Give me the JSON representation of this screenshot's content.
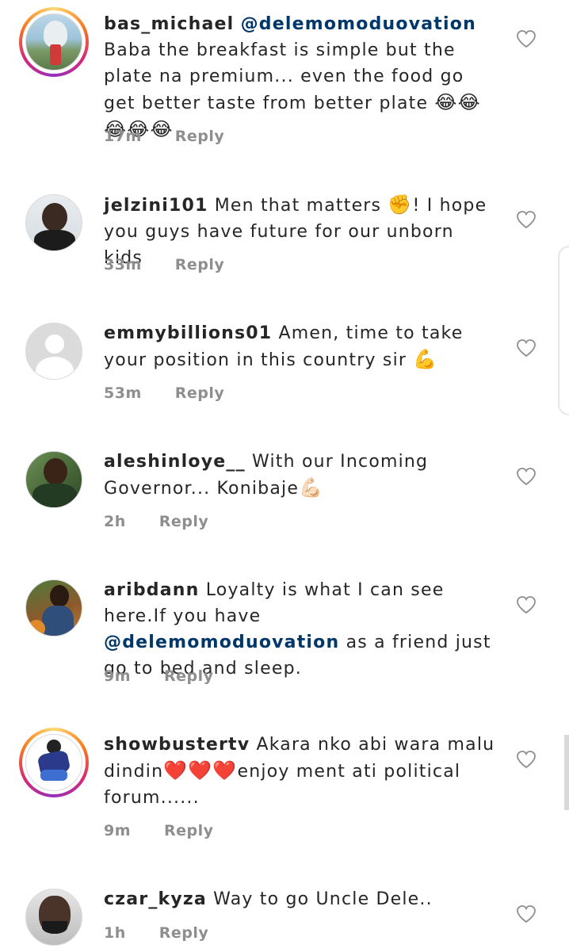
{
  "comments": [
    {
      "username": "bas_michael",
      "mention": "@delemomoduovation",
      "text": "Baba the breakfast is simple but the plate na premium... even the food go get better taste from better plate",
      "emoji": "😂😂😂😂😂",
      "time": "17m",
      "reply": "Reply"
    },
    {
      "username": "jelzini101",
      "text_before": "Men that matters",
      "emoji": "✊",
      "text_after": "! I hope you guys have future for our unborn kids",
      "time": "33m",
      "reply": "Reply"
    },
    {
      "username": "emmybillions01",
      "text": "Amen, time to take your position in this country sir",
      "emoji": "💪",
      "time": "53m",
      "reply": "Reply"
    },
    {
      "username": "aleshinloye__",
      "text": "With our Incoming Governor... Konibaje",
      "emoji": "💪🏻",
      "time": "2h",
      "reply": "Reply"
    },
    {
      "username": "aribdann",
      "text_before": "Loyalty is what I can see here.If you have",
      "mention": "@delemomoduovation",
      "text_after": "as a friend just go to bed and sleep.",
      "time": "9m",
      "reply": "Reply"
    },
    {
      "username": "showbustertv",
      "text_before": "Akara nko abi wara malu dindin",
      "emoji": "❤️❤️❤️",
      "text_after": "enjoy ment ati political forum......",
      "time": "9m",
      "reply": "Reply"
    },
    {
      "username": "czar_kyza",
      "text": "Way to go Uncle Dele..",
      "time": "1h",
      "reply": "Reply"
    }
  ],
  "colors": {
    "mention": "#00376b",
    "meta": "#8e8e8e",
    "text": "#262626"
  },
  "icons": {
    "like": "heart-outline-icon",
    "default_avatar": "default-avatar-icon"
  }
}
